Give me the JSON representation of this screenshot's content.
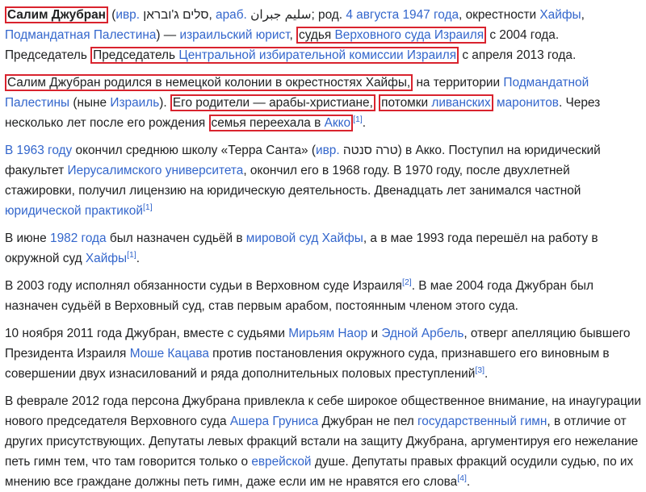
{
  "p1": {
    "name": "Салим Джубран",
    "ivr_abbr": "ивр.",
    "heb_name": "סלים ג'ובראן",
    "arab_abbr": "араб.",
    "arab_name": "سليم جبران",
    "born_prefix": "; род.",
    "birth_date": "4 августа 1947 года",
    "t1": ", окрестности",
    "haifa": "Хайфы",
    "t2": ",",
    "mandate": "Подмандатная Палестина",
    "t3": ") —",
    "lawyer": "израильский юрист",
    "t4": ",",
    "judge_prefix": "судья",
    "supreme_court": "Верховного суда Израиля",
    "t5": "с 2004 года. Председатель",
    "chairman_prefix": "Председатель",
    "election_commission": "Центральной избирательной комиссии Израиля",
    "t6": "с апреля 2013 года."
  },
  "p2": {
    "born_colony": "Салим Джубран родился в немецкой колонии в окрестностях Хайфы,",
    "t1": "на территории",
    "mandatory_palestine": "Подмандатной Палестины",
    "t2": "(ныне",
    "israel": "Израиль",
    "t3": ").",
    "parents": "Его родители — арабы-христиане,",
    "descendants": "потомки",
    "lebanese": "ливанских",
    "maronites": "маронитов",
    "t4": ". Через несколько лет после его рождения",
    "family_moved": "семья переехала в",
    "acre": "Акко",
    "ref": "[1]",
    "t5": "."
  },
  "p3": {
    "year": "В 1963 году",
    "t1": "окончил среднюю школу «Терра Санта» (",
    "ivr_abbr": "ивр.",
    "heb": "טרה סנטה",
    "t2": ") в Акко. Поступил на юридический факультет",
    "university": "Иерусалимского университета",
    "t3": ", окончил его в 1968 году. В 1970 году, после двухлетней стажировки, получил лицензию на юридическую деятельность. Двенадцать лет занимался частной",
    "practice": "юридической практикой",
    "ref": "[1]"
  },
  "p4": {
    "t1": "В июне",
    "year": "1982 года",
    "t2": "был назначен судьёй в",
    "magistrate": "мировой суд Хайфы",
    "t3": ", а в мае 1993 года перешёл на работу в окружной суд",
    "haifa": "Хайфы",
    "ref": "[1]",
    "t4": "."
  },
  "p5": {
    "t1": "В 2003 году исполнял обязанности судьи в Верховном суде Израиля",
    "ref": "[2]",
    "t2": ". В мае 2004 года Джубран был назначен судьёй в Верховный суд, став первым арабом, постоянным членом этого суда."
  },
  "p6": {
    "t1": "10 ноября 2011 года Джубран, вместе с судьями",
    "naor": "Мирьям Наор",
    "t2": "и",
    "arbel": "Эдной Арбель",
    "t3": ", отверг апелляцию бывшего Президента Израиля",
    "katsav": "Моше Кацава",
    "t4": "против постановления окружного суда, признавшего его виновным в совершении двух изнасилований и ряда дополнительных половых преступлений",
    "ref": "[3]",
    "t5": "."
  },
  "p7": {
    "t1": "В феврале 2012 года персона Джубрана привлекла к себе широкое общественное внимание, на инаугурации нового председателя Верховного суда",
    "grunis": "Ашера Груниса",
    "t2": "Джубран не пел",
    "anthem": "государственный гимн",
    "t3": ", в отличие от других присутствующих. Депутаты левых фракций встали на защиту Джубрана, аргументируя его нежелание петь гимн тем, что там говорится только о",
    "jewish": "еврейской",
    "t4": "душе. Депутаты правых фракций осудили судью, по их мнению все граждане должны петь гимн, даже если им не нравятся его слова",
    "ref": "[4]",
    "t5": "."
  }
}
